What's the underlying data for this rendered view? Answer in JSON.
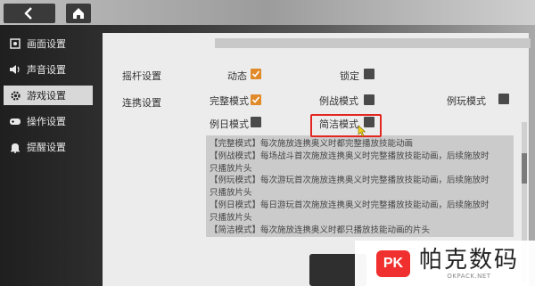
{
  "sidebar": {
    "items": [
      {
        "label": "画面设置",
        "icon": "display-settings-icon",
        "active": false
      },
      {
        "label": "声音设置",
        "icon": "speaker-icon",
        "active": false
      },
      {
        "label": "游戏设置",
        "icon": "gear-icon",
        "active": true
      },
      {
        "label": "操作设置",
        "icon": "gamepad-icon",
        "active": false
      },
      {
        "label": "提醒设置",
        "icon": "bell-icon",
        "active": false
      }
    ]
  },
  "settings": {
    "joystick": {
      "label": "摇杆设置",
      "options": [
        {
          "label": "动态",
          "checked": true
        },
        {
          "label": "锁定",
          "checked": false
        }
      ]
    },
    "link": {
      "label": "连携设置",
      "options": [
        {
          "label": "完整模式",
          "checked": true
        },
        {
          "label": "例战模式",
          "checked": false
        },
        {
          "label": "例玩模式",
          "checked": false
        },
        {
          "label": "例日模式",
          "checked": false
        },
        {
          "label": "简洁模式",
          "checked": false
        }
      ]
    }
  },
  "description": [
    "【完整模式】每次施放连携奥义时都完整播放技能动画",
    "【例战模式】每场战斗首次施放连携奥义时完整播放技能动画，后续施放时",
    "只播放片头",
    "【例玩模式】每次游玩首次施放连携奥义时完整播放技能动画，后续施放时",
    "只播放片头",
    "【例日模式】每日游玩首次施放连携奥义时完整播放技能动画，后续施放时",
    "只播放片头",
    "【简洁模式】每次施放连携奥义时都只播放技能动画的片头"
  ],
  "watermark": {
    "logo": "PK",
    "title": "帕克数码",
    "subtitle": "OKPACK.NET"
  },
  "colors": {
    "accent": "#e08a2a",
    "highlight": "#e3261f",
    "panel": "#ececec"
  }
}
